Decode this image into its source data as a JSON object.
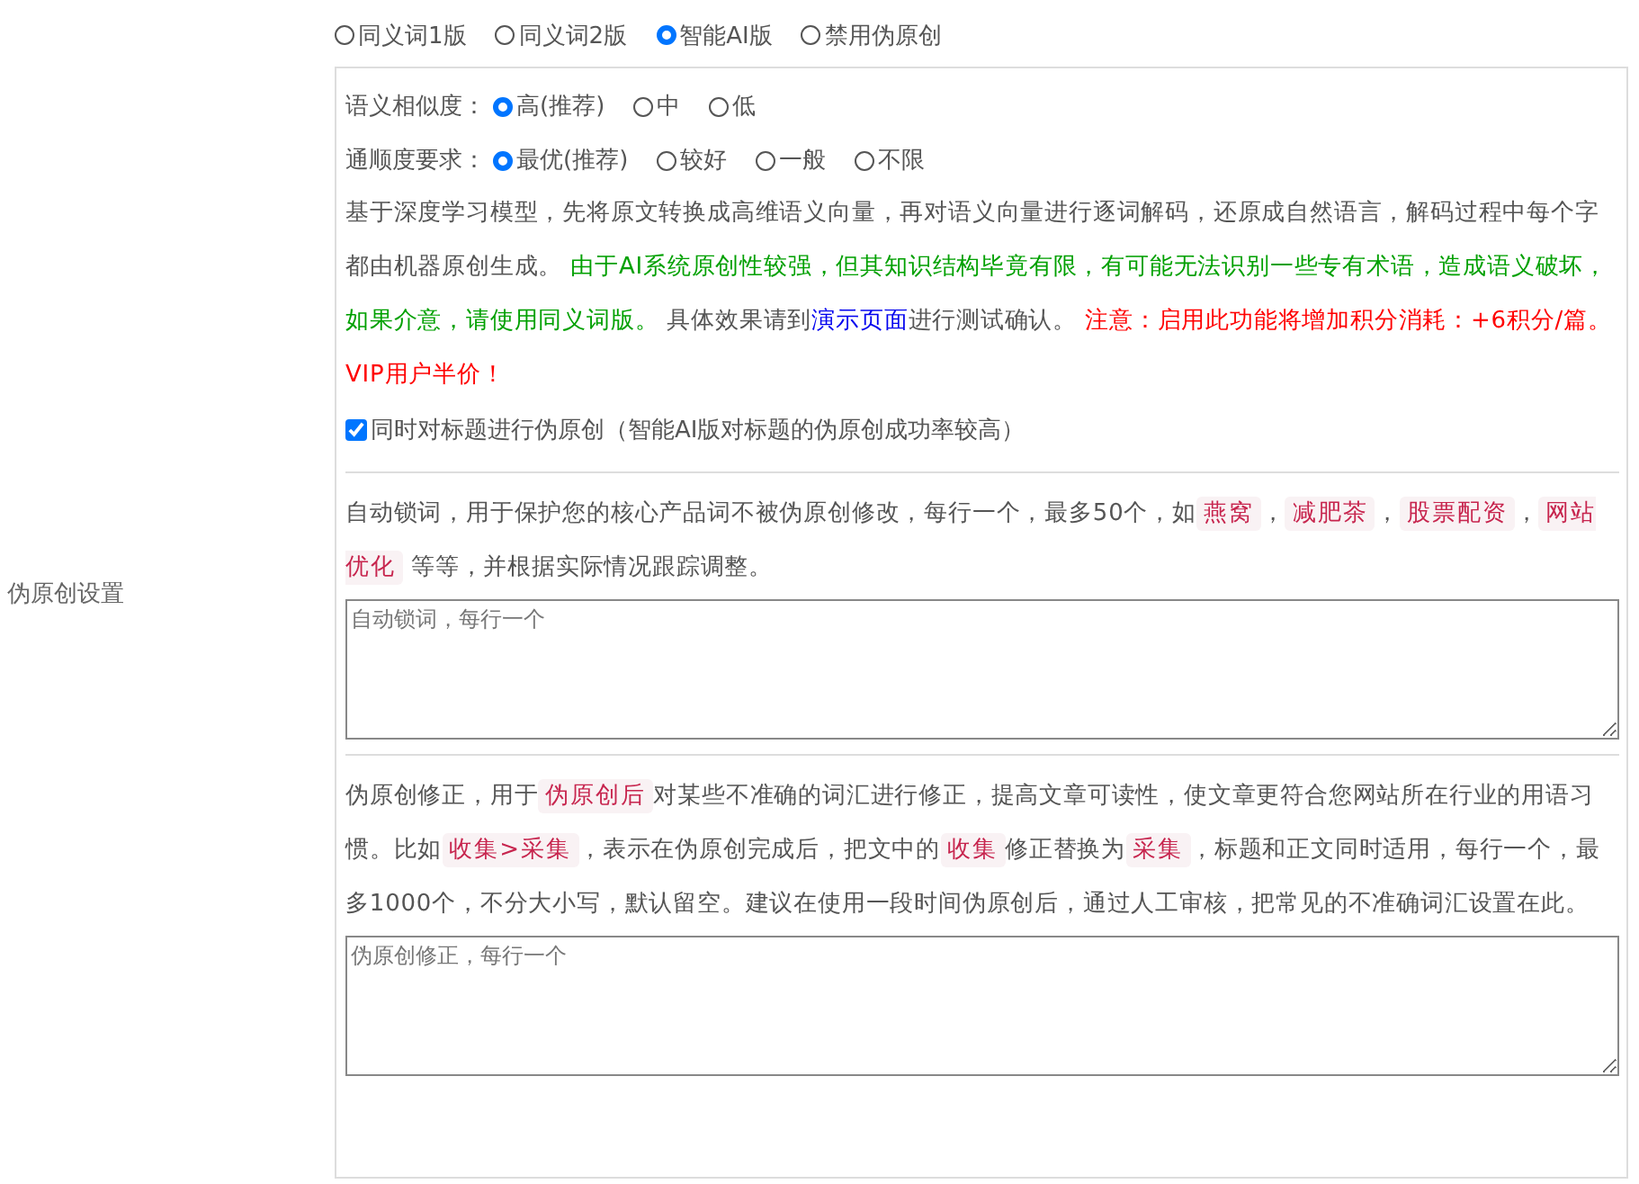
{
  "label": "伪原创设置",
  "modes": [
    {
      "label": "同义词1版",
      "selected": false
    },
    {
      "label": "同义词2版",
      "selected": false
    },
    {
      "label": "智能AI版",
      "selected": true
    },
    {
      "label": "禁用伪原创",
      "selected": false
    }
  ],
  "similarity": {
    "label": "语义相似度：",
    "options": [
      {
        "label": "高(推荐)",
        "selected": true
      },
      {
        "label": "中",
        "selected": false
      },
      {
        "label": "低",
        "selected": false
      }
    ]
  },
  "fluency": {
    "label": "通顺度要求：",
    "options": [
      {
        "label": "最优(推荐)",
        "selected": true
      },
      {
        "label": "较好",
        "selected": false
      },
      {
        "label": "一般",
        "selected": false
      },
      {
        "label": "不限",
        "selected": false
      }
    ]
  },
  "description": [
    {
      "kind": "plain",
      "text": "基于深度学习模型，先将原文转换成高维语义向量，再对语义向量进行逐词解码，还原成自然语言，解码过程中每个字都由机器原创生成。 "
    },
    {
      "kind": "note",
      "text": "由于AI系统原创性较强，但其知识结构毕竟有限，有可能无法识别一些专有术语，造成语义破坏，如果介意，请使用同义词版。"
    },
    {
      "kind": "plain",
      "text": " 具体效果请到"
    },
    {
      "kind": "link",
      "text": "演示页面"
    },
    {
      "kind": "plain",
      "text": "进行测试确认。 "
    },
    {
      "kind": "warning",
      "text": "注意：启用此功能将增加积分消耗：+6积分/篇。VIP用户半价！"
    }
  ],
  "title_option": {
    "label": "同时对标题进行伪原创（智能AI版对标题的伪原创成功率较高）",
    "checked": true
  },
  "lock_words": {
    "description": [
      {
        "kind": "plain",
        "text": "自动锁词，用于保护您的核心产品词不被伪原创修改，每行一个，最多50个，如"
      },
      {
        "kind": "code",
        "text": "燕窝"
      },
      {
        "kind": "plain",
        "text": "，"
      },
      {
        "kind": "code",
        "text": "减肥茶"
      },
      {
        "kind": "plain",
        "text": "，"
      },
      {
        "kind": "code",
        "text": "股票配资"
      },
      {
        "kind": "plain",
        "text": "，"
      },
      {
        "kind": "code",
        "text": "网站优化"
      },
      {
        "kind": "plain",
        "text": " 等等，并根据实际情况跟踪调整。"
      }
    ],
    "placeholder": "自动锁词，每行一个"
  },
  "corrections": {
    "description": [
      {
        "kind": "plain",
        "text": "伪原创修正，用于"
      },
      {
        "kind": "code",
        "text": "伪原创后"
      },
      {
        "kind": "plain",
        "text": "对某些不准确的词汇进行修正，提高文章可读性，使文章更符合您网站所在行业的用语习惯。比如"
      },
      {
        "kind": "code",
        "text": "收集>采集"
      },
      {
        "kind": "plain",
        "text": "，表示在伪原创完成后，把文中的"
      },
      {
        "kind": "code",
        "text": "收集"
      },
      {
        "kind": "plain",
        "text": "修正替换为"
      },
      {
        "kind": "code",
        "text": "采集"
      },
      {
        "kind": "plain",
        "text": "，标题和正文同时适用，每行一个，最多1000个，不分大小写，默认留空。建议在使用一段时间伪原创后，通过人工审核，把常见的不准确词汇设置在此。"
      }
    ],
    "placeholder": "伪原创修正，每行一个"
  }
}
